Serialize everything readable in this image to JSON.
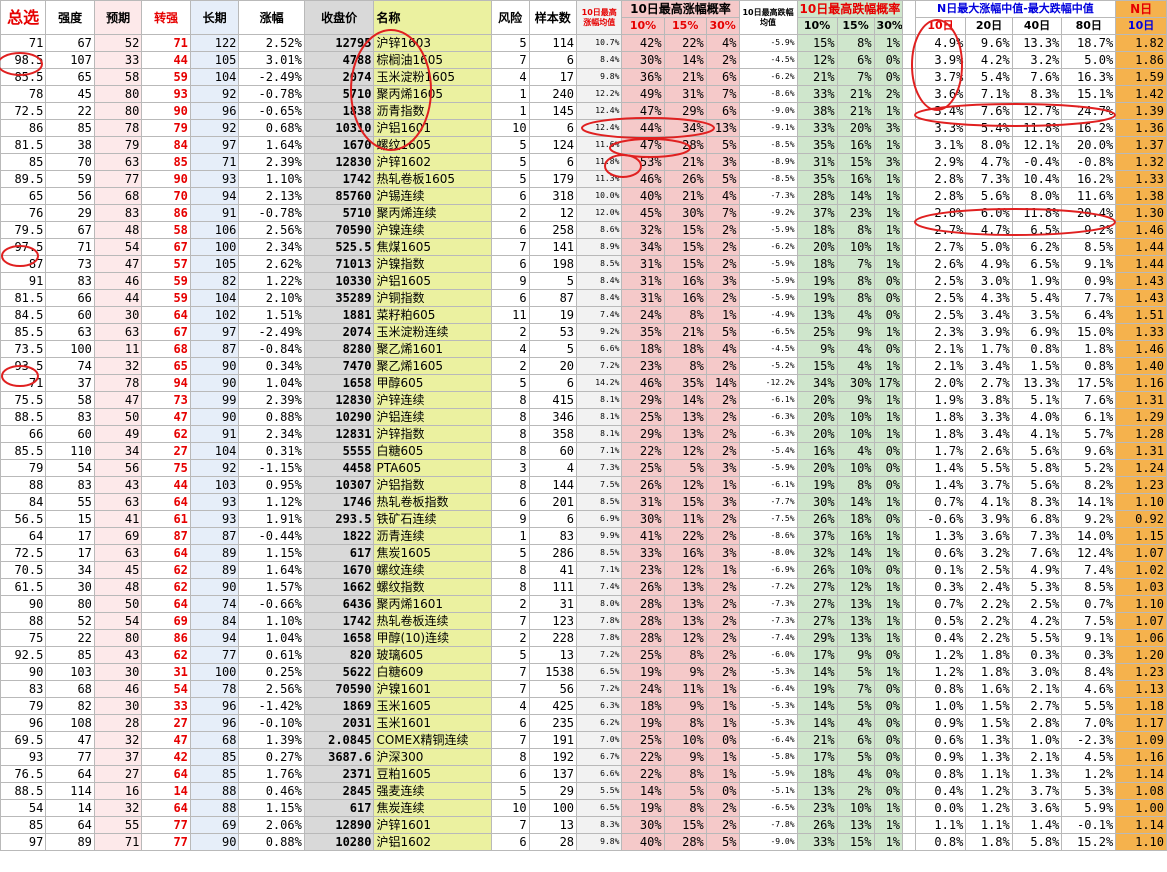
{
  "header": {
    "top": {
      "total": "总选",
      "strength": "强度",
      "expect": "预期",
      "turn": "转强",
      "long": "长期",
      "change": "涨幅",
      "close": "收盘价",
      "name": "名称",
      "risk": "风险",
      "samples": "样本数",
      "max_up_median": "10日最高涨幅均值",
      "up_prob": "10日最高涨幅概率",
      "max_down_median": "10日最高跌幅均值",
      "down_prob": "10日最高跌幅概率",
      "n_day_median": "N日最大涨幅中值-最大跌幅中值",
      "last": "10日",
      "corner": "N日"
    },
    "sub": {
      "p10": "10%",
      "p15": "15%",
      "p30": "30%",
      "d10": "10%",
      "d15": "15%",
      "d30": "30%",
      "n10": "10日",
      "n20": "20日",
      "n40": "40日",
      "n80": "80日",
      "last": "10日"
    }
  },
  "rows": [
    [
      "71",
      "67",
      "52",
      "71",
      "122",
      "2.52%",
      "12795",
      "沪锌1603",
      "5",
      "114",
      "10.7%",
      "42%",
      "22%",
      "4%",
      "-5.9%",
      "15%",
      "8%",
      "1%",
      "4.9%",
      "9.6%",
      "13.3%",
      "18.7%",
      "1.82"
    ],
    [
      "98.5",
      "107",
      "33",
      "44",
      "105",
      "3.01%",
      "4788",
      "棕榈油1605",
      "7",
      "6",
      "8.4%",
      "30%",
      "14%",
      "2%",
      "-4.5%",
      "12%",
      "6%",
      "0%",
      "3.9%",
      "4.2%",
      "3.2%",
      "5.0%",
      "1.86"
    ],
    [
      "85.5",
      "65",
      "58",
      "59",
      "104",
      "-2.49%",
      "2074",
      "玉米淀粉1605",
      "4",
      "17",
      "9.8%",
      "36%",
      "21%",
      "6%",
      "-6.2%",
      "21%",
      "7%",
      "0%",
      "3.7%",
      "5.4%",
      "7.6%",
      "16.3%",
      "1.59"
    ],
    [
      "78",
      "45",
      "80",
      "93",
      "92",
      "-0.78%",
      "5710",
      "聚丙烯1605",
      "1",
      "240",
      "12.2%",
      "49%",
      "31%",
      "7%",
      "-8.6%",
      "33%",
      "21%",
      "2%",
      "3.6%",
      "7.1%",
      "8.3%",
      "15.1%",
      "1.42"
    ],
    [
      "72.5",
      "22",
      "80",
      "90",
      "96",
      "-0.65%",
      "1838",
      "沥青指数",
      "1",
      "145",
      "12.4%",
      "47%",
      "29%",
      "6%",
      "-9.0%",
      "38%",
      "21%",
      "1%",
      "3.4%",
      "7.6%",
      "12.7%",
      "24.7%",
      "1.39"
    ],
    [
      "86",
      "85",
      "78",
      "79",
      "92",
      "0.68%",
      "10310",
      "沪铝1601",
      "10",
      "6",
      "12.4%",
      "44%",
      "34%",
      "13%",
      "-9.1%",
      "33%",
      "20%",
      "3%",
      "3.3%",
      "5.4%",
      "11.8%",
      "16.2%",
      "1.36"
    ],
    [
      "81.5",
      "38",
      "79",
      "84",
      "97",
      "1.64%",
      "1670",
      "螺纹1605",
      "5",
      "124",
      "11.6%",
      "47%",
      "28%",
      "5%",
      "-8.5%",
      "35%",
      "16%",
      "1%",
      "3.1%",
      "8.0%",
      "12.1%",
      "20.0%",
      "1.37"
    ],
    [
      "85",
      "70",
      "63",
      "85",
      "71",
      "2.39%",
      "12830",
      "沪锌1602",
      "5",
      "6",
      "11.8%",
      "53%",
      "21%",
      "3%",
      "-8.9%",
      "31%",
      "15%",
      "3%",
      "2.9%",
      "4.7%",
      "-0.4%",
      "-0.8%",
      "1.32"
    ],
    [
      "89.5",
      "59",
      "77",
      "90",
      "93",
      "1.10%",
      "1742",
      "热轧卷板1605",
      "5",
      "179",
      "11.3%",
      "46%",
      "26%",
      "5%",
      "-8.5%",
      "35%",
      "16%",
      "1%",
      "2.8%",
      "7.3%",
      "10.4%",
      "16.2%",
      "1.33"
    ],
    [
      "65",
      "56",
      "68",
      "70",
      "94",
      "2.13%",
      "85760",
      "沪锡连续",
      "6",
      "318",
      "10.0%",
      "40%",
      "21%",
      "4%",
      "-7.3%",
      "28%",
      "14%",
      "1%",
      "2.8%",
      "5.6%",
      "8.0%",
      "11.6%",
      "1.38"
    ],
    [
      "76",
      "29",
      "83",
      "86",
      "91",
      "-0.78%",
      "5710",
      "聚丙烯连续",
      "2",
      "12",
      "12.0%",
      "45%",
      "30%",
      "7%",
      "-9.2%",
      "37%",
      "23%",
      "1%",
      "2.8%",
      "6.0%",
      "11.8%",
      "20.4%",
      "1.30"
    ],
    [
      "79.5",
      "67",
      "48",
      "58",
      "106",
      "2.56%",
      "70590",
      "沪镍连续",
      "6",
      "258",
      "8.6%",
      "32%",
      "15%",
      "2%",
      "-5.9%",
      "18%",
      "8%",
      "1%",
      "2.7%",
      "4.7%",
      "6.5%",
      "9.2%",
      "1.46"
    ],
    [
      "97.5",
      "71",
      "54",
      "67",
      "100",
      "2.34%",
      "525.5",
      "焦煤1605",
      "7",
      "141",
      "8.9%",
      "34%",
      "15%",
      "2%",
      "-6.2%",
      "20%",
      "10%",
      "1%",
      "2.7%",
      "5.0%",
      "6.2%",
      "8.5%",
      "1.44"
    ],
    [
      "87",
      "73",
      "47",
      "57",
      "105",
      "2.62%",
      "71013",
      "沪镍指数",
      "6",
      "198",
      "8.5%",
      "31%",
      "15%",
      "2%",
      "-5.9%",
      "18%",
      "7%",
      "1%",
      "2.6%",
      "4.9%",
      "6.5%",
      "9.1%",
      "1.44"
    ],
    [
      "91",
      "83",
      "46",
      "59",
      "82",
      "1.22%",
      "10330",
      "沪铝1605",
      "9",
      "5",
      "8.4%",
      "31%",
      "16%",
      "3%",
      "-5.9%",
      "19%",
      "8%",
      "0%",
      "2.5%",
      "3.0%",
      "1.9%",
      "0.9%",
      "1.43"
    ],
    [
      "81.5",
      "66",
      "44",
      "59",
      "104",
      "2.10%",
      "35289",
      "沪铜指数",
      "6",
      "87",
      "8.4%",
      "31%",
      "16%",
      "2%",
      "-5.9%",
      "19%",
      "8%",
      "0%",
      "2.5%",
      "4.3%",
      "5.4%",
      "7.7%",
      "1.43"
    ],
    [
      "84.5",
      "60",
      "30",
      "64",
      "102",
      "1.51%",
      "1881",
      "菜籽粕605",
      "11",
      "19",
      "7.4%",
      "24%",
      "8%",
      "1%",
      "-4.9%",
      "13%",
      "4%",
      "0%",
      "2.5%",
      "3.4%",
      "3.5%",
      "6.4%",
      "1.51"
    ],
    [
      "85.5",
      "63",
      "63",
      "67",
      "97",
      "-2.49%",
      "2074",
      "玉米淀粉连续",
      "2",
      "53",
      "9.2%",
      "35%",
      "21%",
      "5%",
      "-6.5%",
      "25%",
      "9%",
      "1%",
      "2.3%",
      "3.9%",
      "6.9%",
      "15.0%",
      "1.33"
    ],
    [
      "73.5",
      "100",
      "11",
      "68",
      "87",
      "-0.84%",
      "8280",
      "聚乙烯1601",
      "4",
      "5",
      "6.6%",
      "18%",
      "18%",
      "4%",
      "-4.5%",
      "9%",
      "4%",
      "0%",
      "2.1%",
      "1.7%",
      "0.8%",
      "1.8%",
      "1.46"
    ],
    [
      "93.5",
      "74",
      "32",
      "65",
      "90",
      "0.34%",
      "7470",
      "聚乙烯1605",
      "2",
      "20",
      "7.2%",
      "23%",
      "8%",
      "2%",
      "-5.2%",
      "15%",
      "4%",
      "1%",
      "2.1%",
      "3.4%",
      "1.5%",
      "0.8%",
      "1.40"
    ],
    [
      "71",
      "37",
      "78",
      "94",
      "90",
      "1.04%",
      "1658",
      "甲醇605",
      "5",
      "6",
      "14.2%",
      "46%",
      "35%",
      "14%",
      "-12.2%",
      "34%",
      "30%",
      "17%",
      "2.0%",
      "2.7%",
      "13.3%",
      "17.5%",
      "1.16"
    ],
    [
      "75.5",
      "58",
      "47",
      "73",
      "99",
      "2.39%",
      "12830",
      "沪锌连续",
      "8",
      "415",
      "8.1%",
      "29%",
      "14%",
      "2%",
      "-6.1%",
      "20%",
      "9%",
      "1%",
      "1.9%",
      "3.8%",
      "5.1%",
      "7.6%",
      "1.31"
    ],
    [
      "88.5",
      "83",
      "50",
      "47",
      "90",
      "0.88%",
      "10290",
      "沪铝连续",
      "8",
      "346",
      "8.1%",
      "25%",
      "13%",
      "2%",
      "-6.3%",
      "20%",
      "10%",
      "1%",
      "1.8%",
      "3.3%",
      "4.0%",
      "6.1%",
      "1.29"
    ],
    [
      "66",
      "60",
      "49",
      "62",
      "91",
      "2.34%",
      "12831",
      "沪锌指数",
      "8",
      "358",
      "8.1%",
      "29%",
      "13%",
      "2%",
      "-6.3%",
      "20%",
      "10%",
      "1%",
      "1.8%",
      "3.4%",
      "4.1%",
      "5.7%",
      "1.28"
    ],
    [
      "85.5",
      "110",
      "34",
      "27",
      "104",
      "0.31%",
      "5555",
      "白糖605",
      "8",
      "60",
      "7.1%",
      "22%",
      "12%",
      "2%",
      "-5.4%",
      "16%",
      "4%",
      "0%",
      "1.7%",
      "2.6%",
      "5.6%",
      "9.6%",
      "1.31"
    ],
    [
      "79",
      "54",
      "56",
      "75",
      "92",
      "-1.15%",
      "4458",
      "PTA605",
      "3",
      "4",
      "7.3%",
      "25%",
      "5%",
      "3%",
      "-5.9%",
      "20%",
      "10%",
      "0%",
      "1.4%",
      "5.5%",
      "5.8%",
      "5.2%",
      "1.24"
    ],
    [
      "88",
      "83",
      "43",
      "44",
      "103",
      "0.95%",
      "10307",
      "沪铝指数",
      "8",
      "144",
      "7.5%",
      "26%",
      "12%",
      "1%",
      "-6.1%",
      "19%",
      "8%",
      "0%",
      "1.4%",
      "3.7%",
      "5.6%",
      "8.2%",
      "1.23"
    ],
    [
      "84",
      "55",
      "63",
      "64",
      "93",
      "1.12%",
      "1746",
      "热轧卷板指数",
      "6",
      "201",
      "8.5%",
      "31%",
      "15%",
      "3%",
      "-7.7%",
      "30%",
      "14%",
      "1%",
      "0.7%",
      "4.1%",
      "8.3%",
      "14.1%",
      "1.10"
    ],
    [
      "56.5",
      "15",
      "41",
      "61",
      "93",
      "1.91%",
      "293.5",
      "铁矿石连续",
      "9",
      "6",
      "6.9%",
      "30%",
      "11%",
      "2%",
      "-7.5%",
      "26%",
      "18%",
      "0%",
      "-0.6%",
      "3.9%",
      "6.8%",
      "9.2%",
      "0.92"
    ],
    [
      "64",
      "17",
      "69",
      "87",
      "87",
      "-0.44%",
      "1822",
      "沥青连续",
      "1",
      "83",
      "9.9%",
      "41%",
      "22%",
      "2%",
      "-8.6%",
      "37%",
      "16%",
      "1%",
      "1.3%",
      "3.6%",
      "7.3%",
      "14.0%",
      "1.15"
    ],
    [
      "72.5",
      "17",
      "63",
      "64",
      "89",
      "1.15%",
      "617",
      "焦炭1605",
      "5",
      "286",
      "8.5%",
      "33%",
      "16%",
      "3%",
      "-8.0%",
      "32%",
      "14%",
      "1%",
      "0.6%",
      "3.2%",
      "7.6%",
      "12.4%",
      "1.07"
    ],
    [
      "70.5",
      "34",
      "45",
      "62",
      "89",
      "1.64%",
      "1670",
      "螺纹连续",
      "8",
      "41",
      "7.1%",
      "23%",
      "12%",
      "1%",
      "-6.9%",
      "26%",
      "10%",
      "0%",
      "0.1%",
      "2.5%",
      "4.9%",
      "7.4%",
      "1.02"
    ],
    [
      "61.5",
      "30",
      "48",
      "62",
      "90",
      "1.57%",
      "1662",
      "螺纹指数",
      "8",
      "111",
      "7.4%",
      "26%",
      "13%",
      "2%",
      "-7.2%",
      "27%",
      "12%",
      "1%",
      "0.3%",
      "2.4%",
      "5.3%",
      "8.5%",
      "1.03"
    ],
    [
      "90",
      "80",
      "50",
      "64",
      "74",
      "-0.66%",
      "6436",
      "聚丙烯1601",
      "2",
      "31",
      "8.0%",
      "28%",
      "13%",
      "2%",
      "-7.3%",
      "27%",
      "13%",
      "1%",
      "0.7%",
      "2.2%",
      "2.5%",
      "0.7%",
      "1.10"
    ],
    [
      "88",
      "52",
      "54",
      "69",
      "84",
      "1.10%",
      "1742",
      "热轧卷板连续",
      "7",
      "123",
      "7.8%",
      "28%",
      "13%",
      "2%",
      "-7.3%",
      "27%",
      "13%",
      "1%",
      "0.5%",
      "2.2%",
      "4.2%",
      "7.5%",
      "1.07"
    ],
    [
      "75",
      "22",
      "80",
      "86",
      "94",
      "1.04%",
      "1658",
      "甲醇(10)连续",
      "2",
      "228",
      "7.8%",
      "28%",
      "12%",
      "2%",
      "-7.4%",
      "29%",
      "13%",
      "1%",
      "0.4%",
      "2.2%",
      "5.5%",
      "9.1%",
      "1.06"
    ],
    [
      "92.5",
      "85",
      "43",
      "62",
      "77",
      "0.61%",
      "820",
      "玻璃605",
      "5",
      "13",
      "7.2%",
      "25%",
      "8%",
      "2%",
      "-6.0%",
      "17%",
      "9%",
      "0%",
      "1.2%",
      "1.8%",
      "0.3%",
      "0.3%",
      "1.20"
    ],
    [
      "90",
      "103",
      "30",
      "31",
      "100",
      "0.25%",
      "5622",
      "白糖609",
      "7",
      "1538",
      "6.5%",
      "19%",
      "9%",
      "2%",
      "-5.3%",
      "14%",
      "5%",
      "1%",
      "1.2%",
      "1.8%",
      "3.0%",
      "8.4%",
      "1.23"
    ],
    [
      "83",
      "68",
      "46",
      "54",
      "78",
      "2.56%",
      "70590",
      "沪镍1601",
      "7",
      "56",
      "7.2%",
      "24%",
      "11%",
      "1%",
      "-6.4%",
      "19%",
      "7%",
      "0%",
      "0.8%",
      "1.6%",
      "2.1%",
      "4.6%",
      "1.13"
    ],
    [
      "79",
      "82",
      "30",
      "33",
      "96",
      "-1.42%",
      "1869",
      "玉米1605",
      "4",
      "425",
      "6.3%",
      "18%",
      "9%",
      "1%",
      "-5.3%",
      "14%",
      "5%",
      "0%",
      "1.0%",
      "1.5%",
      "2.7%",
      "5.5%",
      "1.18"
    ],
    [
      "96",
      "108",
      "28",
      "27",
      "96",
      "-0.10%",
      "2031",
      "玉米1601",
      "6",
      "235",
      "6.2%",
      "19%",
      "8%",
      "1%",
      "-5.3%",
      "14%",
      "4%",
      "0%",
      "0.9%",
      "1.5%",
      "2.8%",
      "7.0%",
      "1.17"
    ],
    [
      "69.5",
      "47",
      "32",
      "47",
      "68",
      "1.39%",
      "2.0845",
      "COMEX精铜连续",
      "7",
      "191",
      "7.0%",
      "25%",
      "10%",
      "0%",
      "-6.4%",
      "21%",
      "6%",
      "0%",
      "0.6%",
      "1.3%",
      "1.0%",
      "-2.3%",
      "1.09"
    ],
    [
      "93",
      "77",
      "37",
      "42",
      "85",
      "0.27%",
      "3687.6",
      "沪深300",
      "8",
      "192",
      "6.7%",
      "22%",
      "9%",
      "1%",
      "-5.8%",
      "17%",
      "5%",
      "0%",
      "0.9%",
      "1.3%",
      "2.1%",
      "4.5%",
      "1.16"
    ],
    [
      "76.5",
      "64",
      "27",
      "64",
      "85",
      "1.76%",
      "2371",
      "豆粕1605",
      "6",
      "137",
      "6.6%",
      "22%",
      "8%",
      "1%",
      "-5.9%",
      "18%",
      "4%",
      "0%",
      "0.8%",
      "1.1%",
      "1.3%",
      "1.2%",
      "1.14"
    ],
    [
      "88.5",
      "114",
      "16",
      "14",
      "88",
      "0.46%",
      "2845",
      "强麦连续",
      "5",
      "29",
      "5.5%",
      "14%",
      "5%",
      "0%",
      "-5.1%",
      "13%",
      "2%",
      "0%",
      "0.4%",
      "1.2%",
      "3.7%",
      "5.3%",
      "1.08"
    ],
    [
      "54",
      "14",
      "32",
      "64",
      "88",
      "1.15%",
      "617",
      "焦炭连续",
      "10",
      "100",
      "6.5%",
      "19%",
      "8%",
      "2%",
      "-6.5%",
      "23%",
      "10%",
      "1%",
      "0.0%",
      "1.2%",
      "3.6%",
      "5.9%",
      "1.00"
    ],
    [
      "85",
      "64",
      "55",
      "77",
      "69",
      "2.06%",
      "12890",
      "沪锌1601",
      "7",
      "13",
      "8.3%",
      "30%",
      "15%",
      "2%",
      "-7.8%",
      "26%",
      "13%",
      "1%",
      "1.1%",
      "1.1%",
      "1.4%",
      "-0.1%",
      "1.14"
    ],
    [
      "97",
      "89",
      "71",
      "77",
      "90",
      "0.88%",
      "10280",
      "沪铝1602",
      "6",
      "28",
      "9.8%",
      "40%",
      "28%",
      "5%",
      "-9.0%",
      "33%",
      "15%",
      "1%",
      "0.8%",
      "1.8%",
      "5.8%",
      "15.2%",
      "1.10"
    ]
  ]
}
